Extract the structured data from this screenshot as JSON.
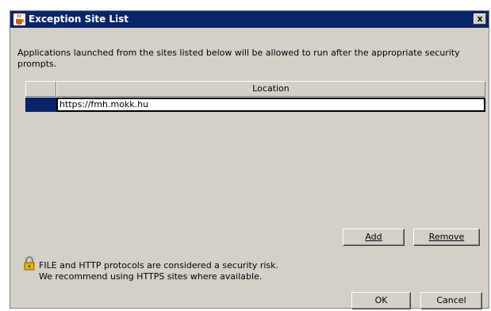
{
  "window": {
    "title": "Exception Site List",
    "close_label": "x"
  },
  "description": "Applications launched from the sites listed below will be allowed to run after the appropriate security prompts.",
  "table": {
    "columns": [
      "",
      "Location"
    ],
    "rows": [
      {
        "location": "https://fmh.mokk.hu"
      }
    ]
  },
  "buttons": {
    "add": "Add",
    "remove": "Remove",
    "ok": "OK",
    "cancel": "Cancel"
  },
  "warning": {
    "line1": "FILE and HTTP protocols are considered a security risk.",
    "line2": "We recommend using HTTPS sites where available."
  },
  "icons": {
    "title": "java-cup-icon",
    "warning": "lock-warning-icon"
  },
  "colors": {
    "titlebar": "#0a246a",
    "dialog": "#d4d0c8"
  }
}
